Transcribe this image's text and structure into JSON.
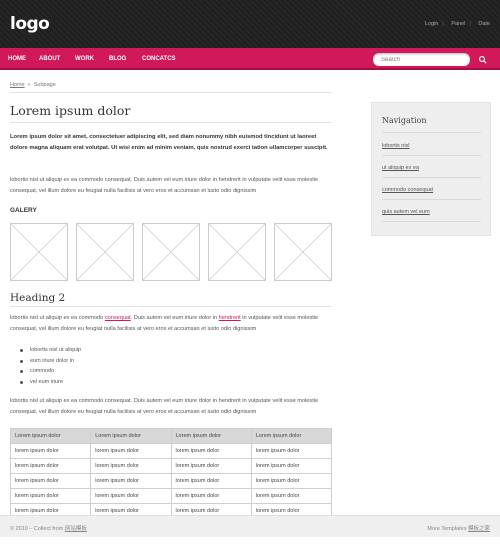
{
  "header": {
    "logo": "logo",
    "top_links": [
      "Login",
      "Panel",
      "Date"
    ]
  },
  "nav": {
    "items": [
      "HOME",
      "ABOUT",
      "WORK",
      "BLOG",
      "CONCATCS"
    ]
  },
  "search": {
    "placeholder": "Search"
  },
  "breadcrumb": {
    "home": "Home",
    "arrow": "»",
    "current": "Subpage"
  },
  "content": {
    "title": "Lorem ipsum dolor",
    "lead": "Lorem ipsum dolor sit amet, consectetuer adipiscing elit, sed diam nonummy nibh euismod tincidunt ut laoreet dolore magna aliquam erat volutpat. Ut wisi enim ad minim veniam, quis nostrud exerci tation ullamcorper suscipit.",
    "para1": "lobortis nisl ut aliquip ex ea commodo consequat. Duis autem vel eum iriure dolor in hendrerit in vulputate velit esse molestie consequat, vel illum dolore eu feugiat nulla facilisis at vero eros et accumsan et iusto odio dignissim",
    "gallery_heading": "GALERY",
    "heading2": "Heading 2",
    "para2": {
      "a": "lobortis nisl ut aliquip ex ea commodo ",
      "link1": "consequat",
      "b": ". Duis autem vel eum iriure dolor in ",
      "link2": "hendrerit",
      "c": " in vulputate velit esse molestie consequat, vel illum dolore eu feugiat nulla facilisis at vero eros et accumsan et iusto odio dignissim"
    },
    "list": [
      "lobortis nisl ut aliquip",
      "eum iriure dolor in",
      "commodo",
      "vel eum iriure"
    ],
    "para3": "lobortis nisl ut aliquip ex ea commodo consequat. Duis autem vel eum iriure dolor in hendrerit in vulputate velit esse molestie consequat, vel illum dolore eu feugiat nulla facilisis at vero eros et accumsan et iusto odio dignissim",
    "table": {
      "headers": [
        "Lorem ipsum dolor",
        "Lorem ipsum dolor",
        "Lorem ipsum dolor",
        "Lorem ipsum dolor"
      ],
      "rows": [
        [
          "lorem ipsum dolor",
          "lorem ipsum dolor",
          "lorem ipsum dolor",
          "lorem ipsum dolor"
        ],
        [
          "lorem ipsum dolor",
          "lorem ipsum dolor",
          "lorem ipsum dolor",
          "lorem ipsum dolor"
        ],
        [
          "lorem ipsum dolor",
          "lorem ipsum dolor",
          "lorem ipsum dolor",
          "lorem ipsum dolor"
        ],
        [
          "lorem ipsum dolor",
          "lorem ipsum dolor",
          "lorem ipsum dolor",
          "lorem ipsum dolor"
        ],
        [
          "lorem ipsum dolor",
          "lorem ipsum dolor",
          "lorem ipsum dolor",
          "lorem ipsum dolor"
        ]
      ]
    }
  },
  "sidebar": {
    "title": "Navigation",
    "items": [
      "lobortis nisl",
      "ut aliquip ex ea",
      "commodo consequat",
      "quis autem vel eum"
    ]
  },
  "footer": {
    "left_text": "© 2010 – Collect from",
    "left_link": "网站模板",
    "right_text": "More Templates",
    "right_link": "模板之家"
  },
  "colors": {
    "accent": "#d1185a",
    "header_bg": "#222222",
    "sidebar_bg": "#eeeeee"
  }
}
